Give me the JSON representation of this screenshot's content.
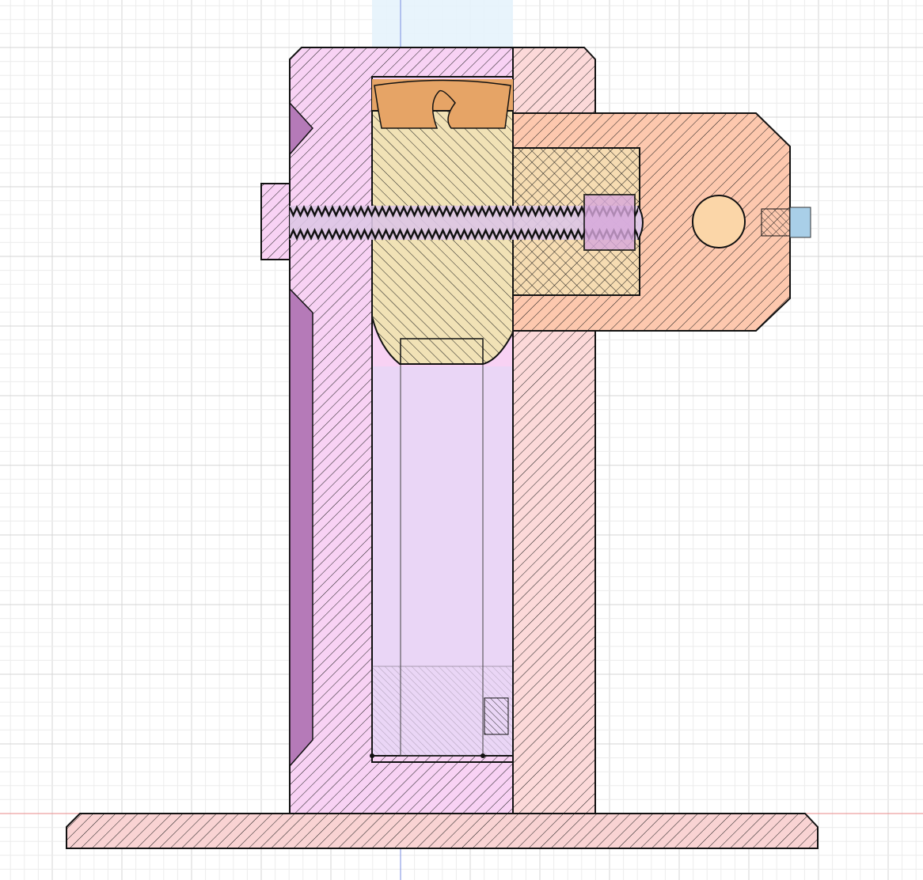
{
  "viewport": {
    "view": "section-analysis",
    "colors": {
      "background": "#ffffff",
      "grid_minor": "#ececec",
      "grid_major": "#d4d4d4",
      "axis_x": "#e88a8a",
      "axis_y": "#7a8ee0",
      "body_pink": "#f8d2f4",
      "body_violet": "#ead6f6",
      "groove_purple": "#b57ab8",
      "column_pink": "#fcd9d9",
      "arm_salmon": "#fdc8ae",
      "slot_yellow": "#f6dcb2",
      "plug_yellow": "#f1e2b6",
      "plug_orange": "#e6a466",
      "screw_lavender": "#ddc6e6",
      "base_pink": "#f9d3d3",
      "bolt_blue": "#a9cfe8",
      "outline": "#111111"
    },
    "parts": [
      {
        "name": "base-plate",
        "icon": "hatched-section"
      },
      {
        "name": "left-body",
        "icon": "hatched-section"
      },
      {
        "name": "right-column",
        "icon": "hatched-section"
      },
      {
        "name": "clamp-arm",
        "icon": "hatched-section"
      },
      {
        "name": "plug",
        "icon": "hatched-section"
      },
      {
        "name": "lead-screw",
        "icon": "thread"
      },
      {
        "name": "knob",
        "icon": "hatched-section"
      },
      {
        "name": "pin",
        "icon": "circle"
      },
      {
        "name": "set-screw",
        "icon": "bolt"
      }
    ]
  }
}
